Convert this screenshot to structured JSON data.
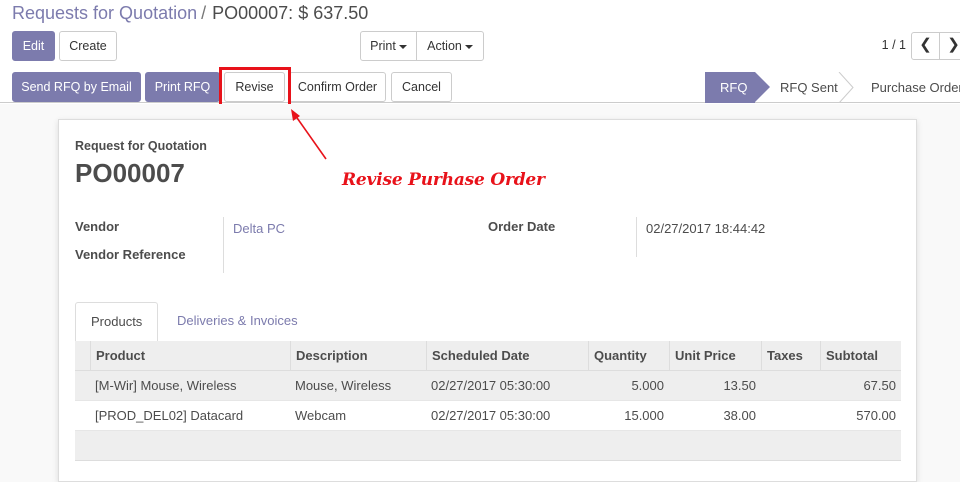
{
  "breadcrumb": {
    "parent": "Requests for Quotation",
    "separator": "/",
    "current": "PO00007: $ 637.50"
  },
  "control": {
    "edit_label": "Edit",
    "create_label": "Create",
    "print_label": "Print",
    "action_label": "Action",
    "pager_value": "1 / 1",
    "prev_glyph": "❮",
    "next_glyph": "❯"
  },
  "statusbar": {
    "buttons": [
      "Send RFQ by Email",
      "Print RFQ",
      "Revise",
      "Confirm Order",
      "Cancel"
    ],
    "stages": [
      "RFQ",
      "RFQ Sent",
      "Purchase Order"
    ],
    "active_stage": "RFQ"
  },
  "annotation": {
    "text": "Revise Purhase Order",
    "color": "#e8121a"
  },
  "form": {
    "subtitle": "Request for Quotation",
    "title": "PO00007",
    "vendor_label": "Vendor",
    "vendor_value": "Delta PC",
    "vendor_ref_label": "Vendor Reference",
    "vendor_ref_value": "",
    "order_date_label": "Order Date",
    "order_date_value": "02/27/2017 18:44:42"
  },
  "tabs": {
    "products": "Products",
    "deliveries": "Deliveries & Invoices"
  },
  "table": {
    "headers": [
      "Product",
      "Description",
      "Scheduled Date",
      "Quantity",
      "Unit Price",
      "Taxes",
      "Subtotal"
    ],
    "rows": [
      [
        "[M-Wir] Mouse, Wireless",
        "Mouse, Wireless",
        "02/27/2017 05:30:00",
        "5.000",
        "13.50",
        "",
        "67.50"
      ],
      [
        "[PROD_DEL02] Datacard",
        "Webcam",
        "02/27/2017 05:30:00",
        "15.000",
        "38.00",
        "",
        "570.00"
      ]
    ]
  },
  "colors": {
    "brand": "#7c7bad",
    "highlight": "#e8121a"
  }
}
